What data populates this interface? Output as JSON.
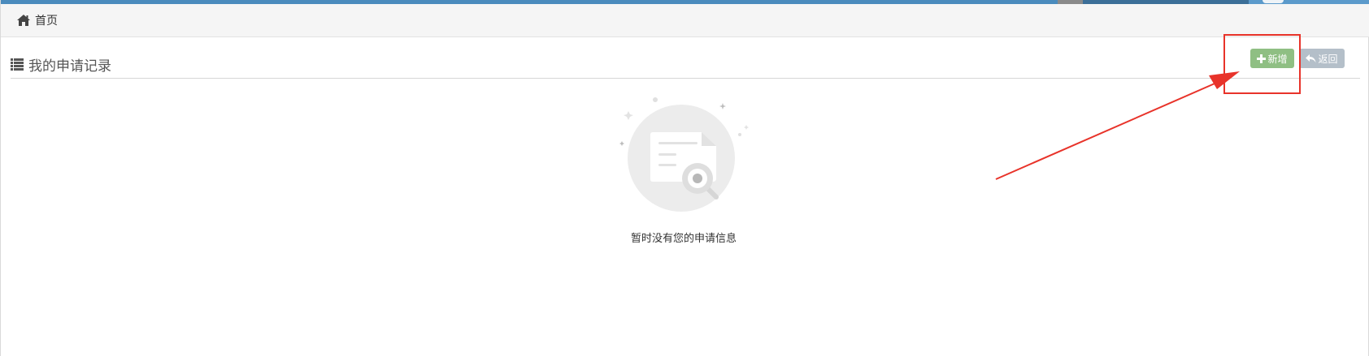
{
  "breadcrumb": {
    "home_label": "首页"
  },
  "section": {
    "title": "我的申请记录"
  },
  "toolbar": {
    "add_label": "新增",
    "back_label": "返回"
  },
  "empty_state": {
    "message": "暂时没有您的申请信息"
  },
  "colors": {
    "topbar": "#4a8bbd",
    "add_button": "#8fbf83",
    "back_button": "#b4bfc9",
    "annotation": "#e8332a"
  },
  "icons": {
    "home": "home-icon",
    "list": "list-icon",
    "plus": "plus-icon",
    "back": "reply-icon",
    "empty": "document-search-icon"
  }
}
